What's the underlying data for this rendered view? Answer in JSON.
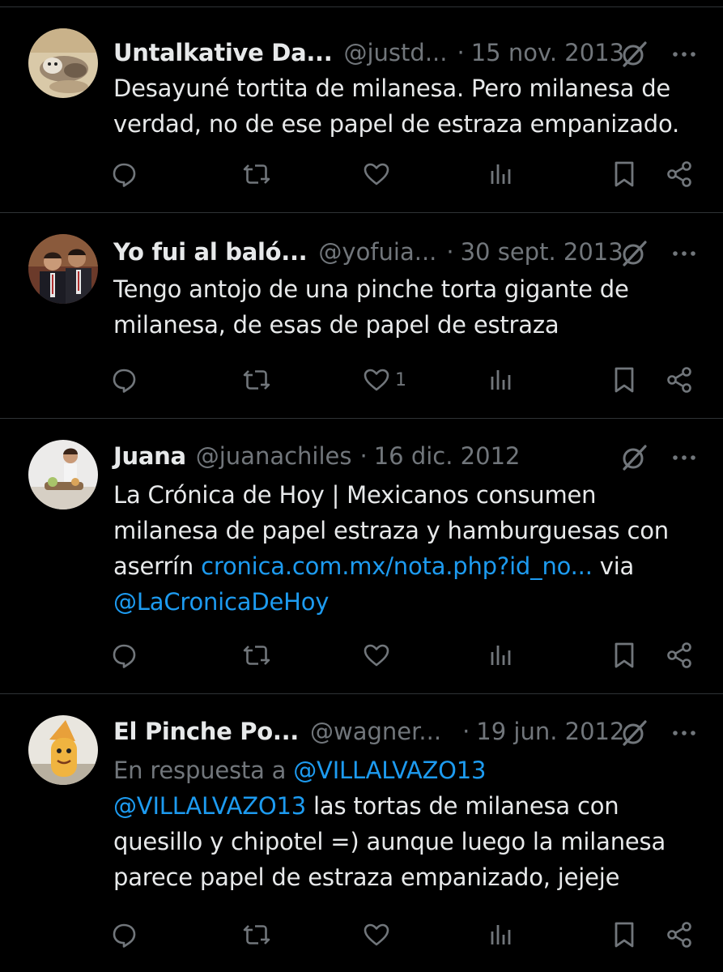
{
  "tweets": [
    {
      "display_name": "Untalkative Da...",
      "handle": "@justd...",
      "separator": "·",
      "date": "15 nov. 2013",
      "text_lines": [
        "Desayuné tortita de milanesa. Pero milanesa de",
        "verdad, no de ese papel de estraza empanizado."
      ],
      "likes": "",
      "avatar": "cat-photo"
    },
    {
      "display_name": "Yo fui al baló...",
      "handle": "@yofuia...",
      "separator": "·",
      "date": "30 sept. 2013",
      "text_lines": [
        "Tengo antojo de una pinche torta gigante de",
        "milanesa, de esas de papel de estraza"
      ],
      "likes": "1",
      "avatar": "two-men-photo"
    },
    {
      "display_name": "Juana",
      "handle": "@juanachiles",
      "separator": "·",
      "date": "16 dic. 2012",
      "text_line1": "La Crónica de Hoy | Mexicanos consumen",
      "text_line2": "milanesa de papel estraza y hamburguesas con",
      "text_line3_plain": "aserrín ",
      "text_line3_link": "cronica.com.mx/nota.php?id_no...",
      "text_line3_tail": " via",
      "text_line4_mention": "@LaCronicaDeHoy",
      "likes": "",
      "avatar": "woman-cooking-photo"
    },
    {
      "display_name": "El Pinche Po...",
      "handle": "@wagner...",
      "separator": "·",
      "date": "19 jun. 2012",
      "reply_prefix": "En respuesta a ",
      "reply_mention": "@VILLALVAZO13",
      "body_mention": "@VILLALVAZO13",
      "body_line1_tail": " las tortas de milanesa con",
      "body_line2": "quesillo y chipotel =) aunque luego la milanesa",
      "body_line3": "parece papel de estraza empanizado, jejeje",
      "likes": "",
      "avatar": "cartoon-character-photo"
    }
  ],
  "icons": {
    "reply": "reply-icon",
    "retweet": "retweet-icon",
    "like": "heart-icon",
    "views": "views-icon",
    "bookmark": "bookmark-icon",
    "share": "share-icon",
    "grok": "grok-icon",
    "more": "more-icon"
  },
  "colors": {
    "background": "#000000",
    "text": "#e7e9ea",
    "secondary": "#71767b",
    "link": "#1d9bf0",
    "divider": "#2f3336"
  }
}
